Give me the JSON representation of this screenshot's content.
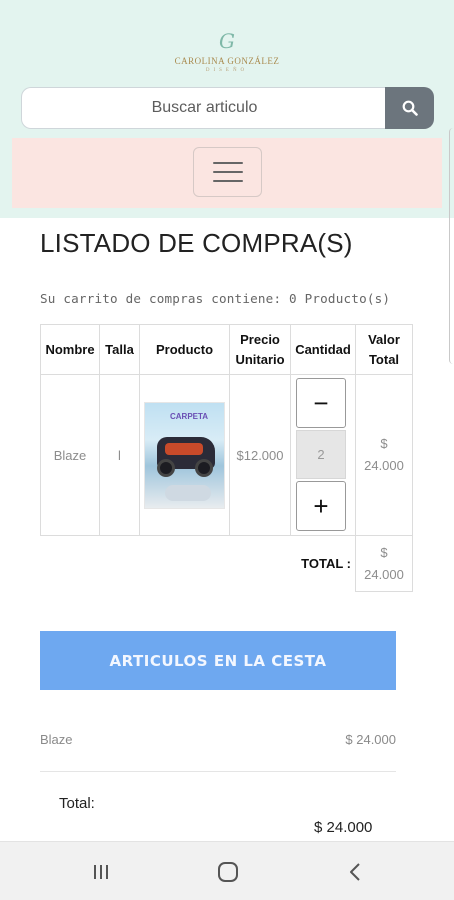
{
  "header": {
    "logo_monogram": "G",
    "logo_name": "CAROLINA GONZÁLEZ",
    "logo_subtitle": "DISEÑO",
    "search_placeholder": "Buscar articulo"
  },
  "page": {
    "title": "LISTADO DE COMPRA(S)",
    "cart_info": "Su carrito de compras contiene: 0 Producto(s)"
  },
  "table": {
    "headers": [
      "Nombre",
      "Talla",
      "Producto",
      "Precio Unitario",
      "Cantidad",
      "Valor Total"
    ],
    "row": {
      "name": "Blaze",
      "size": "l",
      "product_image_label": "CARPETA",
      "unit_price": "$12.000",
      "quantity": "2",
      "minus": "−",
      "plus": "+",
      "total_currency": "$",
      "total_amount": "24.000"
    },
    "total_label": "TOTAL :",
    "total_currency": "$",
    "total_amount": "24.000"
  },
  "basket": {
    "button_label": "ARTICULOS EN LA CESTA",
    "item_name": "Blaze",
    "item_price": "$ 24.000",
    "total_label": "Total:",
    "total_value": "$ 24.000"
  },
  "system_nav": {
    "icons": [
      "recent-apps-icon",
      "home-icon",
      "back-icon"
    ]
  },
  "colors": {
    "header_bg": "#e3f4ef",
    "nav_bg": "#fbe5e1",
    "search_button": "#6c757d",
    "basket_button": "#6ea8f0"
  }
}
